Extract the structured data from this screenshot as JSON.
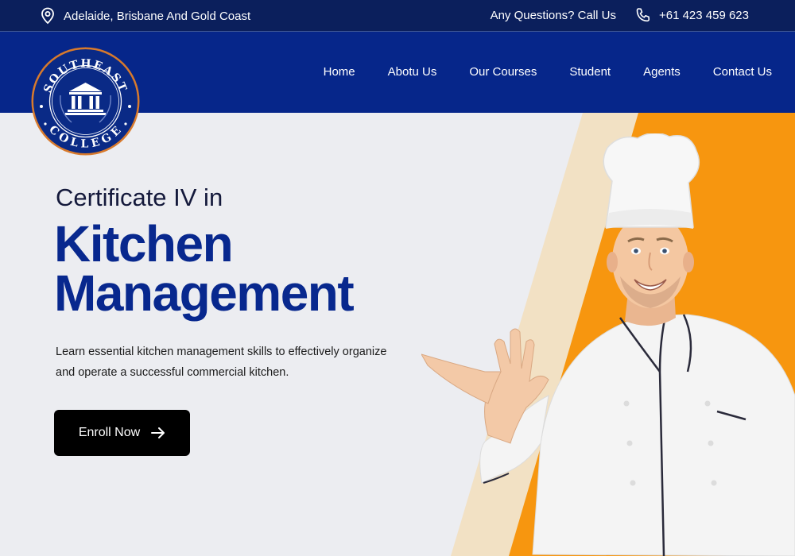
{
  "topbar": {
    "location": "Adelaide, Brisbane And Gold Coast",
    "question": "Any Questions? Call Us",
    "phone": "+61 423 459 623"
  },
  "logo": {
    "top_text": "SOUTHEAST",
    "bottom_text": "COLLEGE"
  },
  "nav": {
    "items": [
      "Home",
      "Abotu Us",
      "Our Courses",
      "Student",
      "Agents",
      "Contact Us"
    ]
  },
  "hero": {
    "subtitle": "Certificate IV in",
    "title_line1": "Kitchen",
    "title_line2": "Management",
    "description": "Learn essential kitchen management skills to effectively organize and operate a successful commercial kitchen.",
    "cta_label": "Enroll Now"
  },
  "colors": {
    "topbar": "#0b1f5c",
    "navbar": "#06268a",
    "accent_orange": "#f7960f",
    "accent_cream": "#f2e1c4",
    "title_blue": "#08288e",
    "hero_bg": "#ecedf1"
  },
  "icons": {
    "location": "location-pin-icon",
    "phone": "phone-icon",
    "arrow": "arrow-right-icon"
  }
}
